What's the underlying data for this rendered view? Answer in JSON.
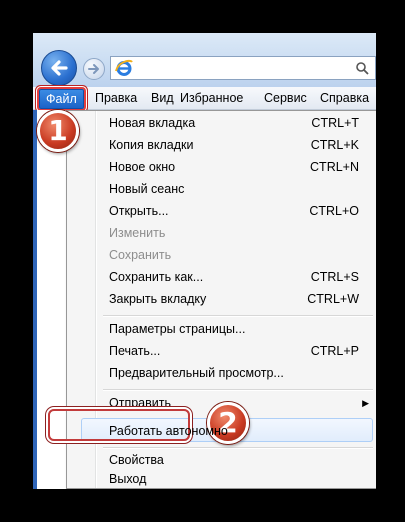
{
  "menubar": {
    "items": [
      "Файл",
      "Правка",
      "Вид",
      "Избранное",
      "Сервис",
      "Справка"
    ]
  },
  "menu": {
    "items": [
      {
        "label": "Новая вкладка",
        "shortcut": "CTRL+T",
        "disabled": false
      },
      {
        "label": "Копия вкладки",
        "shortcut": "CTRL+K",
        "disabled": false
      },
      {
        "label": "Новое окно",
        "shortcut": "CTRL+N",
        "disabled": false
      },
      {
        "label": "Новый сеанс",
        "shortcut": "",
        "disabled": false
      },
      {
        "label": "Открыть...",
        "shortcut": "CTRL+O",
        "disabled": false
      },
      {
        "label": "Изменить",
        "shortcut": "",
        "disabled": true
      },
      {
        "label": "Сохранить",
        "shortcut": "",
        "disabled": true
      },
      {
        "label": "Сохранить как...",
        "shortcut": "CTRL+S",
        "disabled": false
      },
      {
        "label": "Закрыть вкладку",
        "shortcut": "CTRL+W",
        "disabled": false
      },
      {
        "label": "Параметры страницы...",
        "shortcut": "",
        "disabled": false
      },
      {
        "label": "Печать...",
        "shortcut": "CTRL+P",
        "disabled": false
      },
      {
        "label": "Предварительный просмотр...",
        "shortcut": "",
        "disabled": false
      },
      {
        "label": "Отправить",
        "shortcut": "",
        "disabled": false,
        "submenu": true
      },
      {
        "label": "Работать автономно",
        "shortcut": "",
        "disabled": false
      },
      {
        "label": "Свойства",
        "shortcut": "",
        "disabled": false
      },
      {
        "label": "Выход",
        "shortcut": "",
        "disabled": false
      }
    ]
  },
  "badges": {
    "one": "1",
    "two": "2"
  },
  "colors": {
    "accent": "#1b63c8",
    "callout": "#c93a22"
  }
}
